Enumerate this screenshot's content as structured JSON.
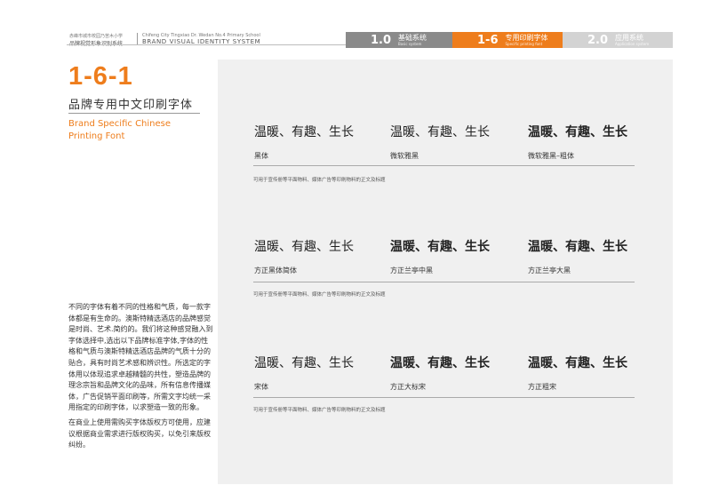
{
  "header": {
    "school_cn_small": "赤峰市城市校园乃苦木小学",
    "school_cn_main": "品牌视觉形象识别系统",
    "school_en_small": "Chifeng City Tingxiao Dr. Wedan No.4 Primary School",
    "system_en": "BRAND VISUAL IDENTITY SYSTEM",
    "tabs": [
      {
        "num": "1.0",
        "cn": "基础系统",
        "en": "Basic system"
      },
      {
        "num": "1-6",
        "cn": "专用印刷字体",
        "en": "Specific printing font"
      },
      {
        "num": "2.0",
        "cn": "应用系统",
        "en": "Application system"
      }
    ]
  },
  "section": {
    "number": "1-6-1",
    "title_cn": "品牌专用中文印刷字体",
    "title_en": "Brand Specific Chinese Printing Font"
  },
  "description": {
    "para1": "不同的字体有着不同的性格和气质，每一款字体都是有生命的。澳斯特精选酒店的品牌感觉是时尚、艺术.简约的。我们将这种感觉融入到字体选择中,选出以下品牌标准字体,字体的性格和气质与澳斯特精选酒店品牌的气质十分的贴合，具有时尚艺术感和辨识性。所选定的字体用以体现追求卓越精髓的共性，塑造品牌的理念宗旨和品牌文化的品味，所有信息传播媒体，广告促销平面印刷等，所需文字均统一采用指定的印刷字体，以求塑造一致的形象。",
    "para2": "在商业上使用需购买字体版权方可使用，应建议根据商业需求进行版权购买，以免引来版权纠纷。"
  },
  "sample_text": "温暖、有趣、生长",
  "groups": [
    {
      "fonts": [
        "黑体",
        "微软雅黑",
        "微软雅黑–粗体"
      ],
      "note": "可用于宣传册等平面物料、媒体广告等印刷物料的正文及标题"
    },
    {
      "fonts": [
        "方正黑体简体",
        "方正兰亭中黑",
        "方正兰亭大黑"
      ],
      "note": "可用于宣传册等平面物料、媒体广告等印刷物料的正文及标题"
    },
    {
      "fonts": [
        "宋体",
        "方正大标宋",
        "方正粗宋"
      ],
      "note": "可用于宣传册等平面物料、媒体广告等印刷物料的正文及标题"
    }
  ],
  "colors": {
    "accent": "#ee7d1c",
    "panel": "#f0f0f0",
    "tab_gray": "#8a8a8a",
    "tab_light": "#d3d3d3"
  }
}
